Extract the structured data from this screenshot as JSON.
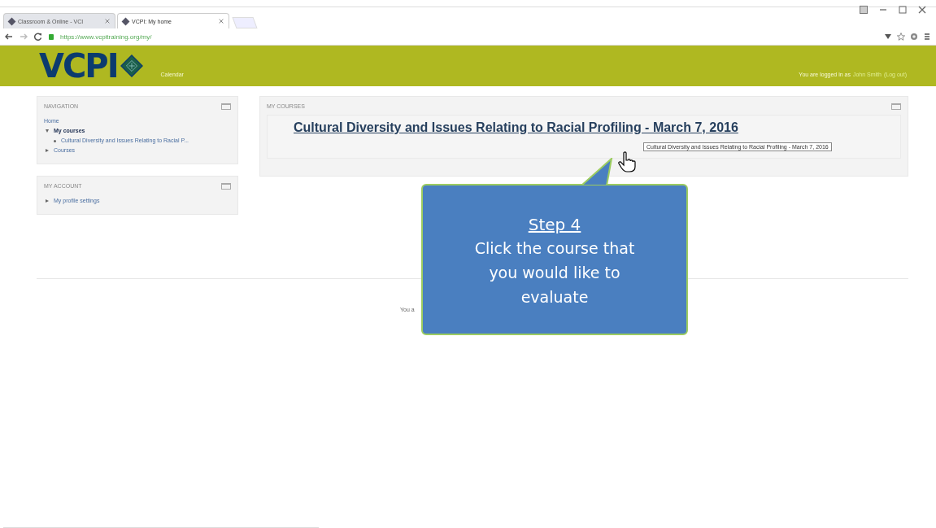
{
  "browser": {
    "tabs": [
      {
        "label": "Classroom & Online - VCI",
        "selected": false
      },
      {
        "label": "VCPI: My home",
        "selected": true
      }
    ],
    "url": "https://www.vcpitraining.org/my/"
  },
  "header": {
    "logo": "VCPI",
    "nav_link": "Calendar",
    "login_text": "You are logged in as",
    "user_name": "John Smith",
    "logout": "(Log out)"
  },
  "sidebar": [
    {
      "title": "NAVIGATION",
      "items": [
        {
          "label": "Home",
          "kind": "link"
        },
        {
          "label": "My courses",
          "kind": "branch",
          "expanded": true,
          "children": [
            {
              "label": "Cultural Diversity and Issues Relating to Racial P..."
            }
          ]
        },
        {
          "label": "Courses",
          "kind": "branch",
          "expanded": false
        }
      ]
    },
    {
      "title": "MY ACCOUNT",
      "items": [
        {
          "label": "My profile settings",
          "kind": "branch",
          "expanded": false
        }
      ]
    }
  ],
  "main": {
    "title": "MY COURSES",
    "course": "Cultural Diversity and Issues Relating to Racial Profiling - March 7, 2016",
    "tooltip": "Cultural Diversity and Issues Relating to Racial Profiling - March 7, 2016"
  },
  "footer_text": "You a",
  "callout": {
    "heading": "Step 4",
    "text": "Click the course that you would like to evaluate"
  }
}
